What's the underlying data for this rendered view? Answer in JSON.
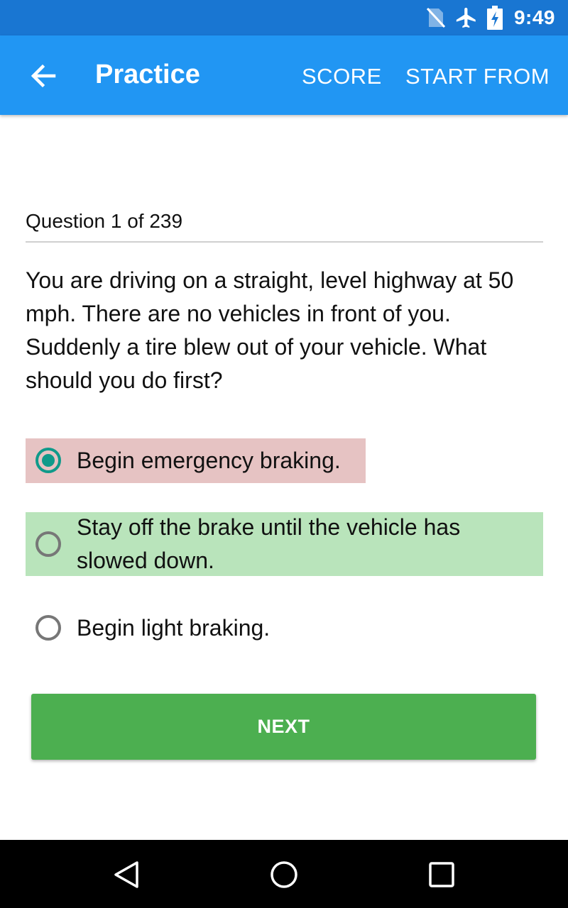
{
  "status_bar": {
    "time": "9:49",
    "icons": [
      "no-sim-icon",
      "airplane-mode-icon",
      "battery-charging-icon"
    ]
  },
  "app_bar": {
    "title": "Practice",
    "back_icon": "arrow-back-icon",
    "actions": [
      "SCORE",
      "START FROM"
    ]
  },
  "quiz": {
    "counter": "Question 1 of 239",
    "question": "You are driving on a straight, level highway at 50 mph. There are no vehicles in front of you. Suddenly a tire blew out of your vehicle. What should you do first?",
    "options": [
      {
        "label": "Begin emergency braking.",
        "selected": true,
        "state": "incorrect"
      },
      {
        "label": "Stay off the brake until the vehicle has slowed down.",
        "selected": false,
        "state": "correct"
      },
      {
        "label": "Begin light braking.",
        "selected": false,
        "state": "neutral"
      }
    ],
    "next_label": "NEXT"
  },
  "colors": {
    "status_bar": "#1976d2",
    "app_bar": "#2196f3",
    "incorrect_highlight": "#e6c3c3",
    "correct_highlight": "#b9e4bb",
    "radio_selected": "#0f9a8a",
    "next_button": "#4caf50"
  },
  "nav_bar": {
    "icons": [
      "nav-back-icon",
      "nav-home-icon",
      "nav-recents-icon"
    ]
  }
}
